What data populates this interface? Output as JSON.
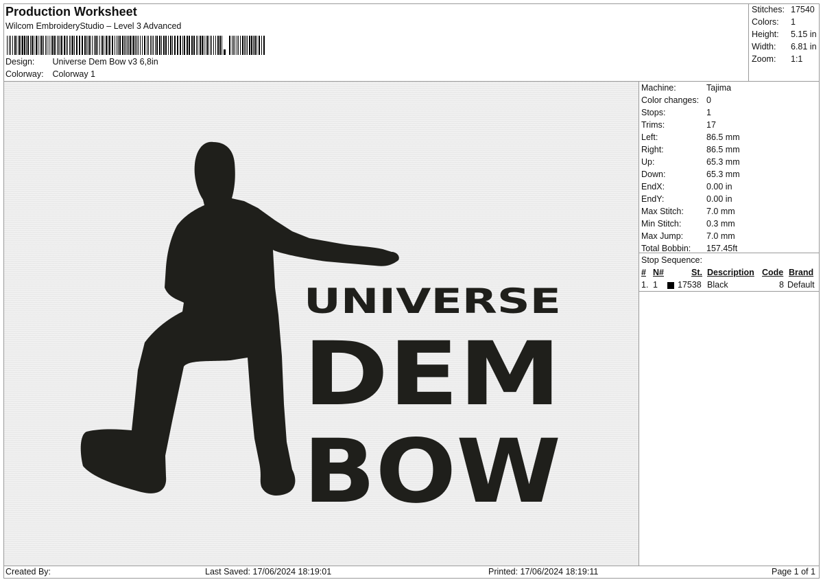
{
  "header": {
    "title": "Production Worksheet",
    "software": "Wilcom EmbroideryStudio – Level 3 Advanced",
    "design_label": "Design:",
    "design_value": "Universe Dem Bow v3 6,8in",
    "colorway_label": "Colorway:",
    "colorway_value": "Colorway 1"
  },
  "summary": {
    "stitches_label": "Stitches:",
    "stitches": "17540",
    "colors_label": "Colors:",
    "colors": "1",
    "height_label": "Height:",
    "height": "5.15 in",
    "width_label": "Width:",
    "width": "6.81 in",
    "zoom_label": "Zoom:",
    "zoom": "1:1"
  },
  "machine_info": [
    {
      "label": "Machine:",
      "value": "Tajima"
    },
    {
      "label": "Color changes:",
      "value": "0"
    },
    {
      "label": "Stops:",
      "value": "1"
    },
    {
      "label": "Trims:",
      "value": "17"
    },
    {
      "label": "Left:",
      "value": "86.5 mm"
    },
    {
      "label": "Right:",
      "value": "86.5 mm"
    },
    {
      "label": "Up:",
      "value": "65.3 mm"
    },
    {
      "label": "Down:",
      "value": "65.3 mm"
    },
    {
      "label": "EndX:",
      "value": "0.00 in"
    },
    {
      "label": "EndY:",
      "value": "0.00 in"
    },
    {
      "label": "Max Stitch:",
      "value": "7.0 mm"
    },
    {
      "label": "Min Stitch:",
      "value": "0.3 mm"
    },
    {
      "label": "Max Jump:",
      "value": "7.0 mm"
    },
    {
      "label": "Total Bobbin:",
      "value": "157.45ft"
    }
  ],
  "stop_sequence": {
    "title": "Stop Sequence:",
    "headers": {
      "num": "#",
      "n": "N#",
      "st": "St.",
      "description": "Description",
      "code": "Code",
      "brand": "Brand"
    },
    "rows": [
      {
        "num": "1.",
        "n": "1",
        "color": "#000000",
        "st": "17538",
        "description": "Black",
        "code": "8",
        "brand": "Default"
      }
    ]
  },
  "design_text": {
    "line1": "UNIVERSE",
    "line2": "DEM",
    "line3": "BOW"
  },
  "colors": {
    "thread": "#1f1f1b",
    "fabric": "#ededed"
  },
  "footer": {
    "created_by": "Created By:",
    "last_saved": "Last Saved: 17/06/2024 18:19:01",
    "printed": "Printed: 17/06/2024 18:19:11",
    "page": "Page 1 of 1"
  }
}
